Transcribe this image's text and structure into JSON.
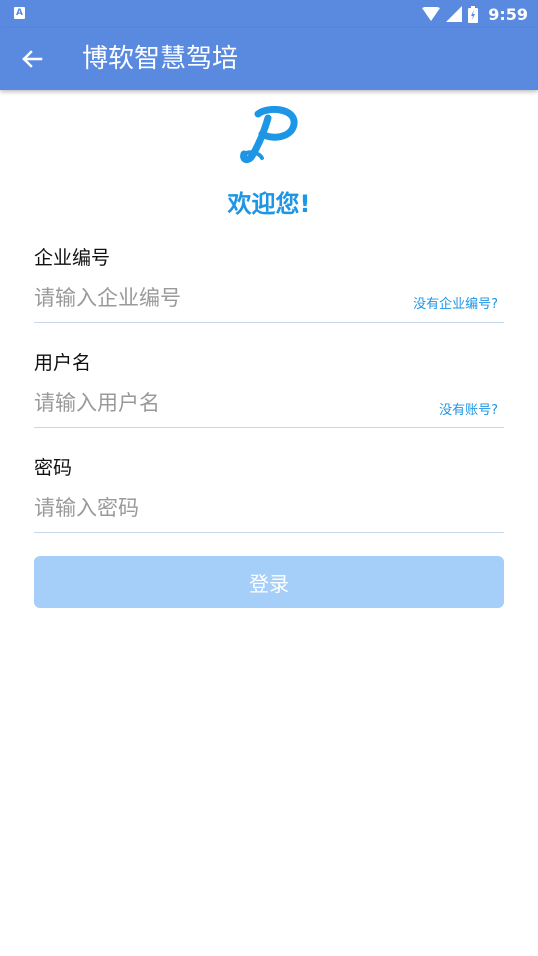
{
  "status_bar": {
    "time": "9:59",
    "icons": [
      "notification-a-icon",
      "wifi-icon",
      "signal-icon",
      "battery-icon"
    ]
  },
  "app_bar": {
    "title": "博软智慧驾培",
    "back_icon": "arrow-left-icon"
  },
  "welcome": "欢迎您!",
  "form": {
    "company": {
      "label": "企业编号",
      "placeholder": "请输入企业编号",
      "value": "",
      "link": "没有企业编号?"
    },
    "username": {
      "label": "用户名",
      "placeholder": "请输入用户名",
      "value": "",
      "link": "没有账号?"
    },
    "password": {
      "label": "密码",
      "placeholder": "请输入密码",
      "value": ""
    },
    "login_label": "登录"
  },
  "colors": {
    "primary": "#5a8ae0",
    "accent": "#1e96e6",
    "button_disabled": "#a5cff8"
  }
}
